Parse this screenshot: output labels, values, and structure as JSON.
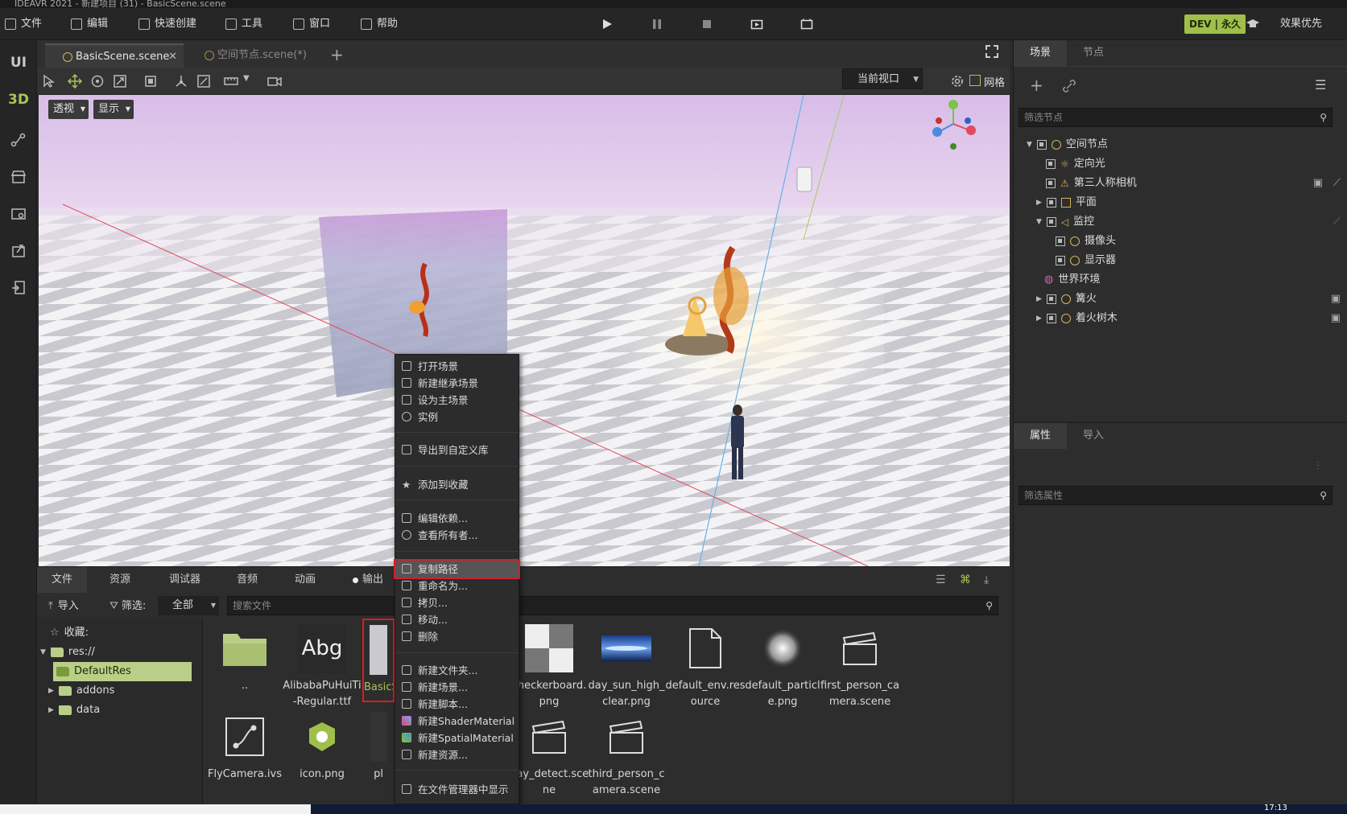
{
  "window": {
    "title": "IDEAVR 2021 - 新建项目 (31) - BasicScene.scene"
  },
  "menu": {
    "items": [
      {
        "label": "文件",
        "icon": "folder-icon"
      },
      {
        "label": "编辑",
        "icon": "edit-icon"
      },
      {
        "label": "快速创建",
        "icon": "quick-create-icon"
      },
      {
        "label": "工具",
        "icon": "toolbox-icon"
      },
      {
        "label": "窗口",
        "icon": "window-icon"
      },
      {
        "label": "帮助",
        "icon": "help-icon"
      }
    ],
    "license_badge": "DEV | 永久",
    "render_mode": "效果优先"
  },
  "sidebar": {
    "ui_label": "UI",
    "label_3d": "3D"
  },
  "doc_tabs": [
    {
      "label": "BasicScene.scene",
      "active": true
    },
    {
      "label": "空间节点.scene(*)",
      "active": false
    }
  ],
  "toolbar": {
    "viewport_select": "当前视口",
    "grid_label": "网格"
  },
  "viewport": {
    "perspective_btn": "透视",
    "display_btn": "显示"
  },
  "scene_panel": {
    "tabs": [
      "场景",
      "节点"
    ],
    "filter_placeholder": "筛选节点",
    "nodes": [
      {
        "label": "空间节点",
        "depth": 0,
        "expanded": true
      },
      {
        "label": "定向光",
        "depth": 1
      },
      {
        "label": "第三人称相机",
        "depth": 1
      },
      {
        "label": "平面",
        "depth": 1,
        "collapsed": true
      },
      {
        "label": "监控",
        "depth": 1,
        "expanded": true
      },
      {
        "label": "摄像头",
        "depth": 2
      },
      {
        "label": "显示器",
        "depth": 2
      },
      {
        "label": "世界环境",
        "depth": 1
      },
      {
        "label": "篝火",
        "depth": 1,
        "collapsed": true
      },
      {
        "label": "着火树木",
        "depth": 1,
        "collapsed": true
      }
    ]
  },
  "props_panel": {
    "tabs": [
      "属性",
      "导入"
    ],
    "filter_placeholder": "筛选属性"
  },
  "bottom_panel": {
    "tabs": [
      "文件",
      "资源",
      "调试器",
      "音频",
      "动画",
      "输出"
    ],
    "import_label": "导入",
    "filter_label": "筛选:",
    "filter_value": "全部",
    "search_placeholder": "搜索文件",
    "tree": {
      "favorites": "收藏:",
      "root": "res://",
      "items": [
        "DefaultRes",
        "addons",
        "data"
      ]
    },
    "files_row1": [
      {
        "name": "..",
        "kind": "folder"
      },
      {
        "name": "AlibabaPuHuiTi-Regular.ttf",
        "kind": "font",
        "thumb_text": "Abg"
      },
      {
        "name": "BasicScene.scene",
        "kind": "scene-selected"
      },
      {
        "name": "checkerboard.png",
        "kind": "checker"
      },
      {
        "name": "day_sun_high_clear.png",
        "kind": "sky"
      },
      {
        "name": "default_env.resource",
        "kind": "doc"
      },
      {
        "name": "default_particle.png",
        "kind": "glow"
      },
      {
        "name": "first_person_camera.scene",
        "kind": "clapper"
      }
    ],
    "files_row2": [
      {
        "name": "FlyCamera.ivs",
        "kind": "graph"
      },
      {
        "name": "icon.png",
        "kind": "icon"
      },
      {
        "name": "pl",
        "kind": "partial"
      },
      {
        "name": "Ray_detect.scene",
        "kind": "clapper"
      },
      {
        "name": "third_person_camera.scene",
        "kind": "clapper"
      }
    ]
  },
  "context_menu": {
    "items": [
      {
        "label": "打开场景"
      },
      {
        "label": "新建继承场景"
      },
      {
        "label": "设为主场景"
      },
      {
        "label": "实例"
      },
      {
        "label": "导出到自定义库"
      },
      {
        "label": "添加到收藏"
      },
      {
        "label": "编辑依赖..."
      },
      {
        "label": "查看所有者..."
      },
      {
        "label": "复制路径",
        "highlighted": true
      },
      {
        "label": "重命名为..."
      },
      {
        "label": "拷贝..."
      },
      {
        "label": "移动..."
      },
      {
        "label": "删除"
      },
      {
        "label": "新建文件夹..."
      },
      {
        "label": "新建场景..."
      },
      {
        "label": "新建脚本..."
      },
      {
        "label": "新建ShaderMaterial"
      },
      {
        "label": "新建SpatialMaterial"
      },
      {
        "label": "新建资源..."
      },
      {
        "label": "在文件管理器中显示"
      }
    ]
  },
  "taskbar": {
    "clock": "17:13"
  },
  "colors": {
    "accent": "#9fbf4a",
    "highlight_border": "#d0202a",
    "selected_folder": "#b9cf88"
  }
}
